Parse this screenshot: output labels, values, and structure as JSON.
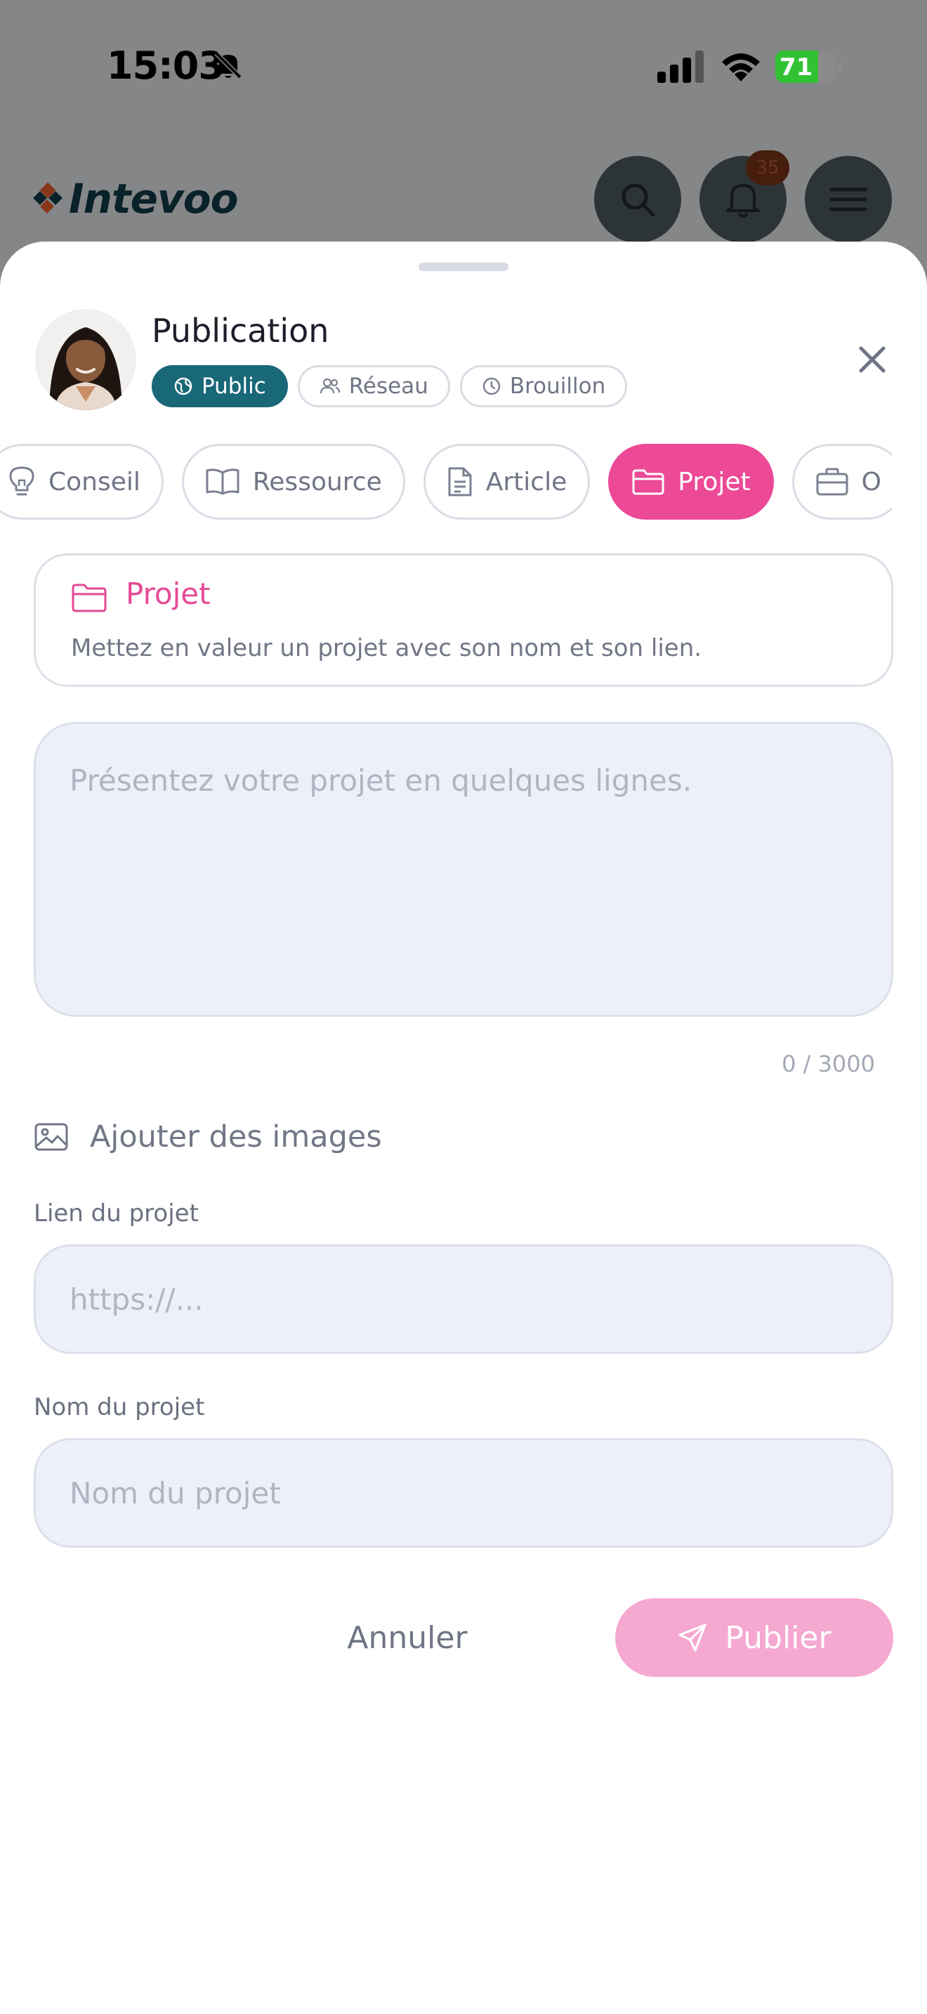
{
  "status_bar": {
    "time": "15:03",
    "battery_percent": "71",
    "battery_level": 0.71
  },
  "app": {
    "logo_text": "Intevoo",
    "notification_count": "35"
  },
  "composer": {
    "title": "Publication",
    "visibility": [
      {
        "label": "Public",
        "icon": "globe-icon",
        "active": true
      },
      {
        "label": "Réseau",
        "icon": "users-icon",
        "active": false
      },
      {
        "label": "Brouillon",
        "icon": "clock-icon",
        "active": false
      }
    ],
    "post_types": [
      {
        "label": "Conseil",
        "icon": "lightbulb-icon",
        "active": false
      },
      {
        "label": "Ressource",
        "icon": "book-icon",
        "active": false
      },
      {
        "label": "Article",
        "icon": "document-icon",
        "active": false
      },
      {
        "label": "Projet",
        "icon": "folder-icon",
        "active": true
      },
      {
        "label": "O",
        "icon": "briefcase-icon",
        "active": false
      }
    ],
    "type_info": {
      "title": "Projet",
      "description": "Mettez en valeur un projet avec son nom et son lien."
    },
    "text": {
      "placeholder": "Présentez votre projet en quelques lignes.",
      "counter": "0 / 3000"
    },
    "add_images_label": "Ajouter des images",
    "project_link": {
      "label": "Lien du projet",
      "placeholder": "https://..."
    },
    "project_name": {
      "label": "Nom du projet",
      "placeholder": "Nom du projet"
    },
    "cancel_label": "Annuler",
    "publish_label": "Publier"
  },
  "colors": {
    "accent_pink": "#ec4996",
    "publish_disabled": "#f5a8d0",
    "public_teal": "#196878",
    "logo_navy": "#103a45"
  }
}
